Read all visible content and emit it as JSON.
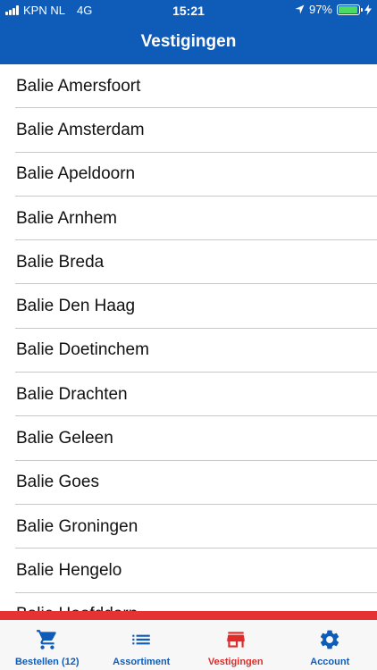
{
  "status_bar": {
    "carrier": "KPN NL",
    "network": "4G",
    "time": "15:21",
    "battery": "97%",
    "battery_level": 0.97
  },
  "header": {
    "title": "Vestigingen"
  },
  "locations": [
    "Balie Amersfoort",
    "Balie Amsterdam",
    "Balie Apeldoorn",
    "Balie Arnhem",
    "Balie Breda",
    "Balie Den Haag",
    "Balie Doetinchem",
    "Balie Drachten",
    "Balie Geleen",
    "Balie Goes",
    "Balie Groningen",
    "Balie Hengelo",
    "Balie Hoofddorp"
  ],
  "tabs": [
    {
      "label": "Bestellen (12)",
      "icon": "cart-icon",
      "active": false
    },
    {
      "label": "Assortiment",
      "icon": "list-icon",
      "active": false
    },
    {
      "label": "Vestigingen",
      "icon": "store-icon",
      "active": true
    },
    {
      "label": "Account",
      "icon": "gear-icon",
      "active": false
    }
  ],
  "colors": {
    "primary": "#0f5cb8",
    "accent_red": "#e02b2b",
    "battery_green": "#4cd964"
  }
}
